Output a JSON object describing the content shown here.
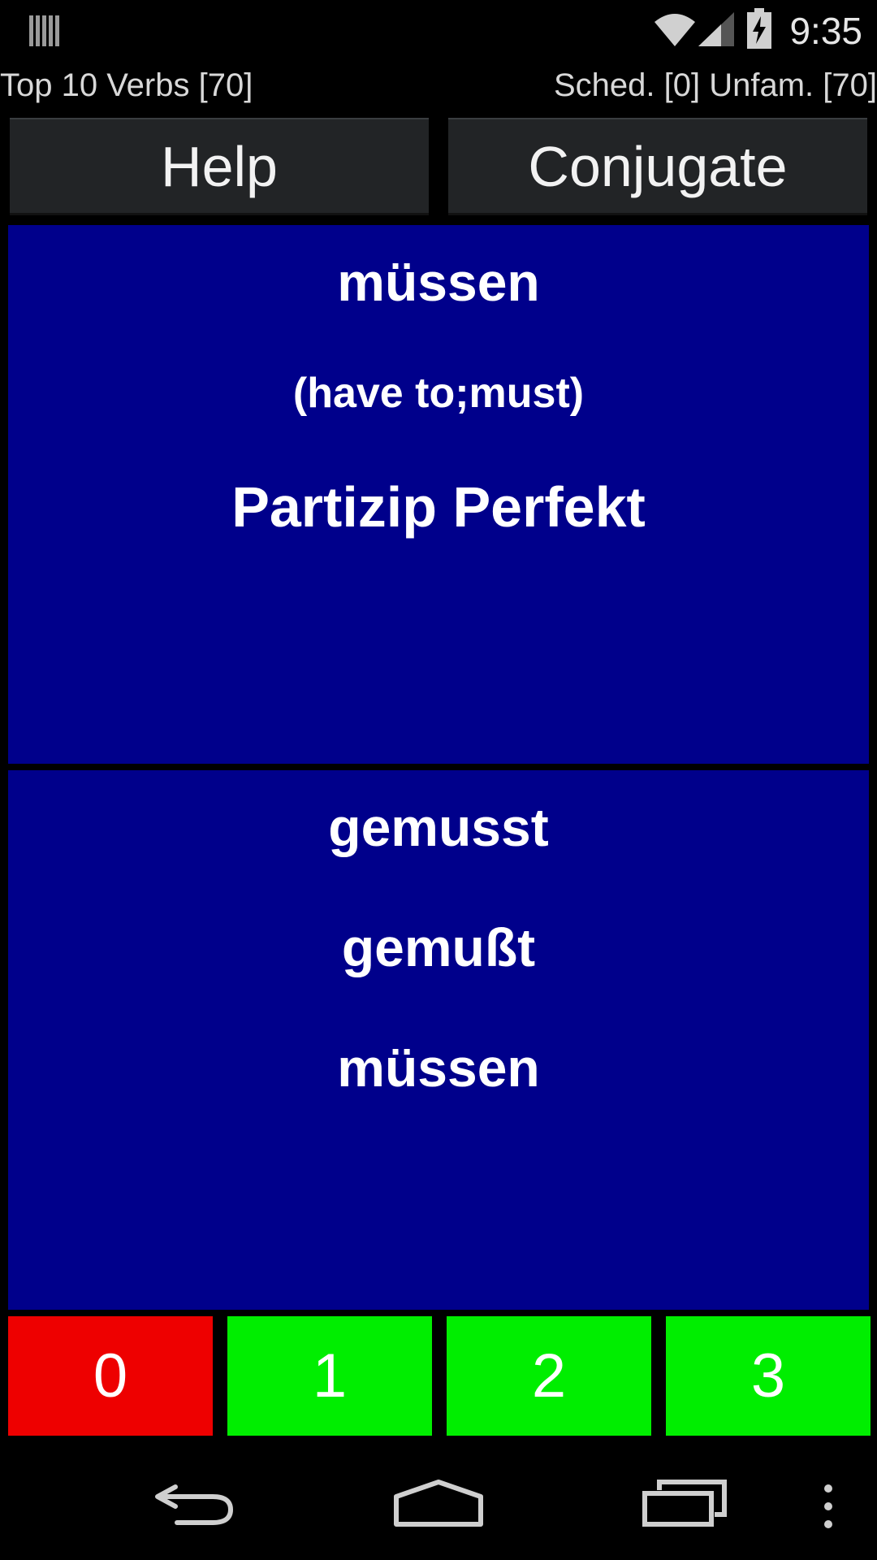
{
  "status_bar": {
    "time": "9:35",
    "icons": [
      "notification-icon",
      "wifi-icon",
      "signal-icon",
      "battery-charging-icon"
    ]
  },
  "info": {
    "deck_title": "Top 10 Verbs [70]",
    "stats": "Sched. [0] Unfam. [70]"
  },
  "buttons": {
    "help": "Help",
    "conjugate": "Conjugate"
  },
  "card_front": {
    "word": "müssen",
    "meaning": "(have to;must)",
    "tense": "Partizip Perfekt"
  },
  "card_back": {
    "answers": [
      "gemusst",
      "gemußt",
      "müssen"
    ]
  },
  "ratings": {
    "items": [
      {
        "label": "0",
        "color": "#ee0000"
      },
      {
        "label": "1",
        "color": "#00ee00"
      },
      {
        "label": "2",
        "color": "#00ee00"
      },
      {
        "label": "3",
        "color": "#00ee00"
      }
    ]
  },
  "nav_bar": {
    "icons": [
      "back-icon",
      "home-icon",
      "recents-icon",
      "overflow-menu-icon"
    ]
  },
  "colors": {
    "card_background": "#00008b",
    "button_background": "#222426"
  }
}
